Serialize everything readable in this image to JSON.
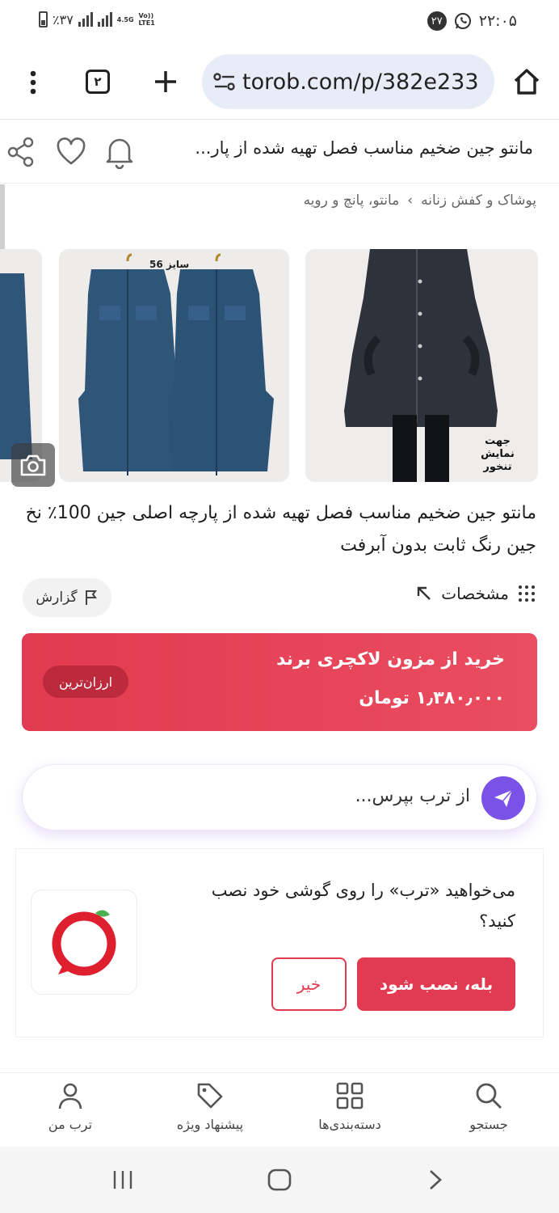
{
  "status": {
    "battery_text": "٪۳۷",
    "network_small": "4.5G",
    "volte": "Vo))",
    "lte": "LTE1",
    "notification_count": "۲۷",
    "time": "۲۲:۰۵"
  },
  "browser": {
    "url": "torob.com/p/382e233",
    "tab_count": "۲"
  },
  "header": {
    "title": "مانتو جین ضخیم مناسب فصل تهیه شده از پار..."
  },
  "breadcrumb": [
    "پوشاک و کفش زنانه",
    "›",
    "مانتو، پانچ و رویه"
  ],
  "images": {
    "size_label": "سایز 56",
    "overlay_text": "جهت نمایش تنخور"
  },
  "product": {
    "title": "مانتو جین ضخیم مناسب فصل تهیه شده از پارچه اصلی جین 100٪ نخ جین رنگ ثابت بدون آبرفت"
  },
  "actions": {
    "specs_label": "مشخصات",
    "report_label": "گزارش"
  },
  "buy": {
    "shop_label": "خرید از مزون لاکچری برند",
    "price": "۱٫۳۸۰٫۰۰۰ تومان",
    "cheapest_badge": "ارزان‌ترین"
  },
  "ask": {
    "placeholder": "از ترب بپرس..."
  },
  "install": {
    "question": "می‌خواهید «ترب» را روی گوشی خود نصب کنید؟",
    "yes_label": "بله، نصب شود",
    "no_label": "خیر"
  },
  "bottom_nav": [
    {
      "label": "جستجو",
      "icon": "search-icon"
    },
    {
      "label": "دسته‌بندی‌ها",
      "icon": "grid-icon"
    },
    {
      "label": "پیشنهاد ویژه",
      "icon": "tag-icon"
    },
    {
      "label": "ترب من",
      "icon": "user-icon"
    }
  ],
  "colors": {
    "accent": "#e23a50",
    "ask_purple": "#7b52e8",
    "url_bg": "#e8ecf7"
  }
}
